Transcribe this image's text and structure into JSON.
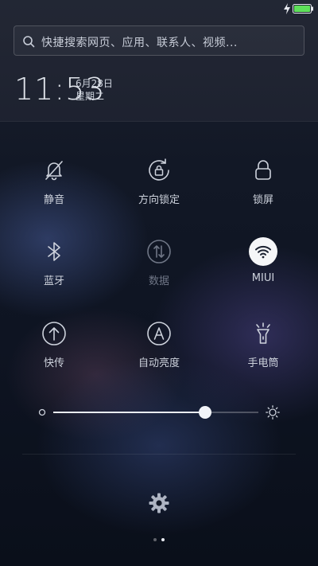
{
  "search": {
    "placeholder": "快捷搜索网页、应用、联系人、视频..."
  },
  "clock": {
    "time": "11:53",
    "date": "6月28日",
    "weekday": "星期二"
  },
  "tiles": [
    {
      "label": "静音",
      "icon": "bell-off-icon",
      "active": false
    },
    {
      "label": "方向锁定",
      "icon": "rotation-lock-icon",
      "active": false
    },
    {
      "label": "锁屏",
      "icon": "lock-icon",
      "active": false
    },
    {
      "label": "蓝牙",
      "icon": "bluetooth-icon",
      "active": false
    },
    {
      "label": "数据",
      "icon": "mobile-data-icon",
      "active": false,
      "disabled": true
    },
    {
      "label": "MIUI",
      "icon": "wifi-icon",
      "active": true
    },
    {
      "label": "快传",
      "icon": "quick-transfer-icon",
      "active": false
    },
    {
      "label": "自动亮度",
      "icon": "auto-brightness-icon",
      "active": false
    },
    {
      "label": "手电筒",
      "icon": "flashlight-icon",
      "active": false
    }
  ],
  "brightness": {
    "level": 0.74
  },
  "pager": {
    "pages": 2,
    "current": 2
  },
  "colors": {
    "battery": "#5ee05a",
    "active_tile": "#f5f6f8",
    "disabled_text": "#6f7686"
  }
}
